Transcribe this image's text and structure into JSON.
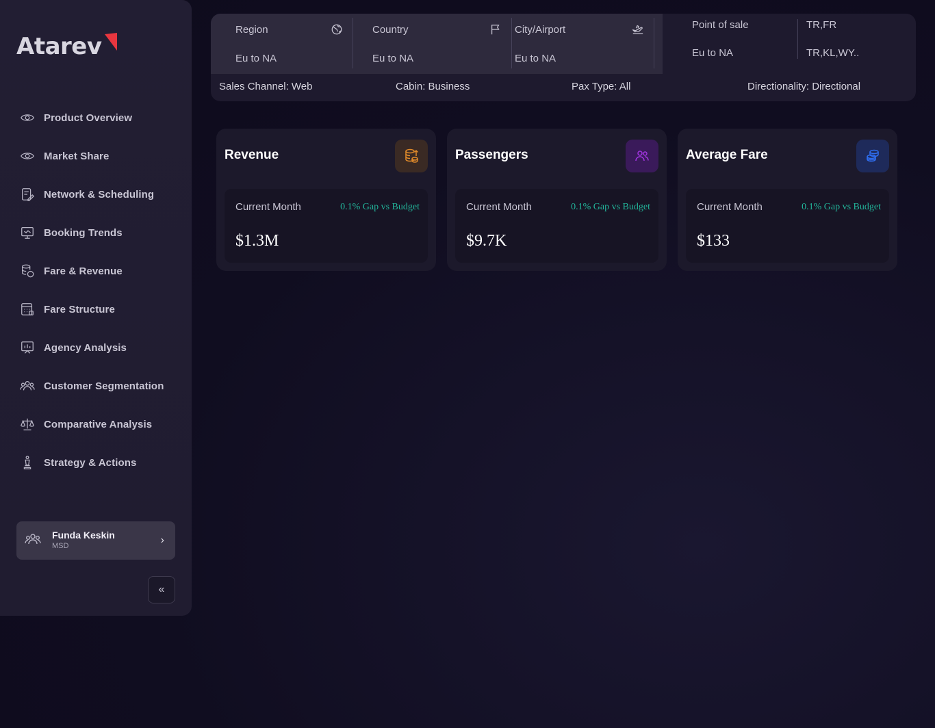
{
  "brand": {
    "name": "Atarev",
    "mark_color": "#e8363f"
  },
  "nav": {
    "items": [
      {
        "label": "Product Overview",
        "icon": "eye-icon"
      },
      {
        "label": "Market Share",
        "icon": "eye-icon"
      },
      {
        "label": "Network & Scheduling",
        "icon": "document-edit-icon"
      },
      {
        "label": "Booking Trends",
        "icon": "screen-icon"
      },
      {
        "label": "Fare & Revenue",
        "icon": "coins-icon"
      },
      {
        "label": "Fare Structure",
        "icon": "calculator-icon"
      },
      {
        "label": "Agency Analysis",
        "icon": "presentation-chart-icon"
      },
      {
        "label": "Customer Segmentation",
        "icon": "users-icon"
      },
      {
        "label": "Comparative Analysis",
        "icon": "scale-icon"
      },
      {
        "label": "Strategy & Actions",
        "icon": "chess-piece-icon"
      }
    ]
  },
  "user": {
    "name": "Funda Keskin",
    "role": "MSD",
    "icon": "users-icon"
  },
  "collapse": {
    "icon": "double-chevron-left-icon"
  },
  "filters": {
    "region": {
      "title": "Region",
      "value": "Eu to NA",
      "icon": "globe-icon"
    },
    "country": {
      "title": "Country",
      "value": "Eu to NA",
      "icon": "flag-icon"
    },
    "city": {
      "title": "City/Airport",
      "value": "Eu to NA",
      "icon": "plane-icon"
    },
    "pos": {
      "title": "Point of sale",
      "value": "Eu to NA",
      "title_right": "TR,FR",
      "value_right": "TR,KL,WY.."
    },
    "sales_channel": "Sales Channel: Web",
    "cabin": "Cabin: Business",
    "pax_type": "Pax Type: All",
    "directionality": "Directionality: Directional"
  },
  "cards": [
    {
      "title": "Revenue",
      "icon": "coins-up-icon",
      "icon_color": "#e08a2a",
      "icon_bg": "#3a2a24",
      "label": "Current Month",
      "gap": "0.1% Gap vs Budget",
      "value": "$1.3M"
    },
    {
      "title": "Passengers",
      "icon": "users-icon",
      "icon_color": "#a235e0",
      "icon_bg": "#3a1a5a",
      "label": "Current Month",
      "gap": "0.1% Gap vs Budget",
      "value": "$9.7K"
    },
    {
      "title": "Average Fare",
      "icon": "coin-stack-icon",
      "icon_color": "#2f6ef0",
      "icon_bg": "#1e2a5a",
      "label": "Current Month",
      "gap": "0.1% Gap vs Budget",
      "value": "$133"
    }
  ]
}
